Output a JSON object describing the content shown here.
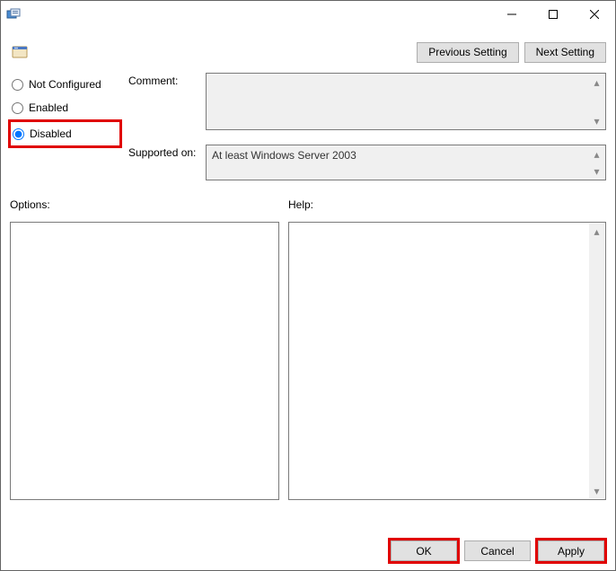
{
  "window": {
    "title": ""
  },
  "nav": {
    "previous": "Previous Setting",
    "next": "Next Setting"
  },
  "radios": {
    "not_configured": "Not Configured",
    "enabled": "Enabled",
    "disabled": "Disabled",
    "selected": "disabled"
  },
  "labels": {
    "comment": "Comment:",
    "supported_on": "Supported on:",
    "options": "Options:",
    "help": "Help:"
  },
  "fields": {
    "comment": "",
    "supported_on": "At least Windows Server 2003",
    "options": "",
    "help": ""
  },
  "buttons": {
    "ok": "OK",
    "cancel": "Cancel",
    "apply": "Apply"
  }
}
